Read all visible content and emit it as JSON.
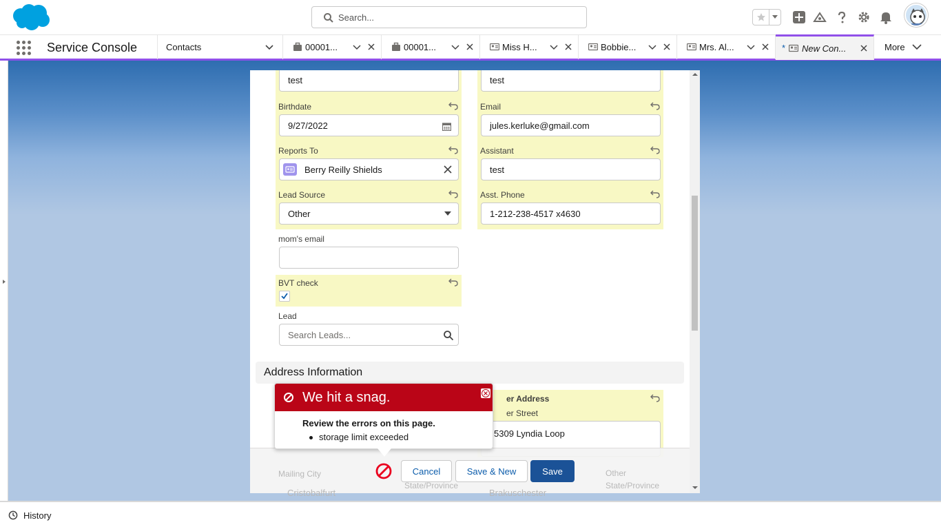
{
  "header": {
    "search_placeholder": "Search..."
  },
  "nav": {
    "app_name": "Service Console",
    "contacts_tab": "Contacts",
    "tabs": [
      {
        "label": "00001...",
        "icon": "briefcase-icon"
      },
      {
        "label": "00001...",
        "icon": "briefcase-icon"
      },
      {
        "label": "Miss H...",
        "icon": "contact-card-icon"
      },
      {
        "label": "Bobbie...",
        "icon": "contact-card-icon"
      },
      {
        "label": "Mrs. Al...",
        "icon": "contact-card-icon"
      },
      {
        "label": "New Con...",
        "icon": "contact-card-icon",
        "dirty_marker": "*",
        "active": true
      }
    ],
    "more_label": "More"
  },
  "form": {
    "top_left_value": "test",
    "top_right_value": "test",
    "birthdate": {
      "label": "Birthdate",
      "value": "9/27/2022"
    },
    "email": {
      "label": "Email",
      "value": "jules.kerluke@gmail.com"
    },
    "reports_to": {
      "label": "Reports To",
      "value": "Berry Reilly Shields"
    },
    "assistant": {
      "label": "Assistant",
      "value": "test"
    },
    "lead_source": {
      "label": "Lead Source",
      "value": "Other"
    },
    "asst_phone": {
      "label": "Asst. Phone",
      "value": "1-212-238-4517 x4630"
    },
    "moms_email": {
      "label": "mom's email",
      "value": ""
    },
    "bvt_check": {
      "label": "BVT check",
      "checked": true
    },
    "lead": {
      "label": "Lead",
      "placeholder": "Search Leads..."
    },
    "address_section": "Address Information",
    "other_address_label": "er Address",
    "other_street_label": "er Street",
    "other_street_value": "5309 Lyndia Loop",
    "mailing_city_label": "Mailing City",
    "mailing_city_value": "Cristobalfurt",
    "mailing_state_label": "State/Province",
    "other_city_value": "Brakuschester",
    "other_state_label_1": "Other",
    "other_state_label_2": "State/Province"
  },
  "error": {
    "title": "We hit a snag.",
    "message": "Review the errors on this page.",
    "items": [
      "storage limit exceeded"
    ]
  },
  "footer": {
    "cancel": "Cancel",
    "save_new": "Save & New",
    "save": "Save"
  },
  "utility": {
    "history": "History"
  },
  "colors": {
    "brand_purple": "#9050e9",
    "error_red": "#ba0517",
    "save_blue": "#1b5297",
    "highlight_yellow": "#f8f8c4"
  }
}
